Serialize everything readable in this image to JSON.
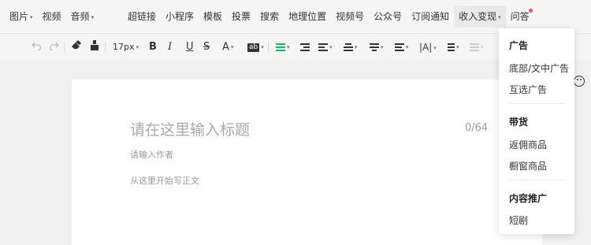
{
  "menubar": {
    "left_items": [
      {
        "label": "图片",
        "caret": "▾"
      },
      {
        "label": "视频"
      },
      {
        "label": "音频",
        "caret": "▾"
      }
    ],
    "right_items": [
      {
        "label": "超链接"
      },
      {
        "label": "小程序"
      },
      {
        "label": "模板"
      },
      {
        "label": "投票"
      },
      {
        "label": "搜索"
      },
      {
        "label": "地理位置"
      },
      {
        "label": "视频号"
      },
      {
        "label": "公众号"
      },
      {
        "label": "订阅通知"
      },
      {
        "label": "收入变现",
        "caret": "▾"
      },
      {
        "label": "问答"
      }
    ]
  },
  "toolbar": {
    "font_size": "17px",
    "bold": "B",
    "italic": "I",
    "underline": "U",
    "strike": "S",
    "font_color": "A",
    "bg_color": "ab",
    "letter_spacing": "|A|",
    "caret": "▾"
  },
  "editor": {
    "title_placeholder": "请在这里输入标题",
    "title_counter": "0/64",
    "author_placeholder": "请输入作者",
    "body_placeholder": "从这里开始写正文"
  },
  "dropdown": {
    "sections": [
      {
        "header": "广告",
        "items": [
          "底部/文中广告",
          "互选广告"
        ]
      },
      {
        "header": "带货",
        "items": [
          "返佣商品",
          "橱窗商品"
        ]
      },
      {
        "header": "内容推广",
        "items": [
          "短剧"
        ]
      }
    ]
  },
  "colors": {
    "accent_green": "#07c160",
    "notification_red": "#fa5151"
  }
}
